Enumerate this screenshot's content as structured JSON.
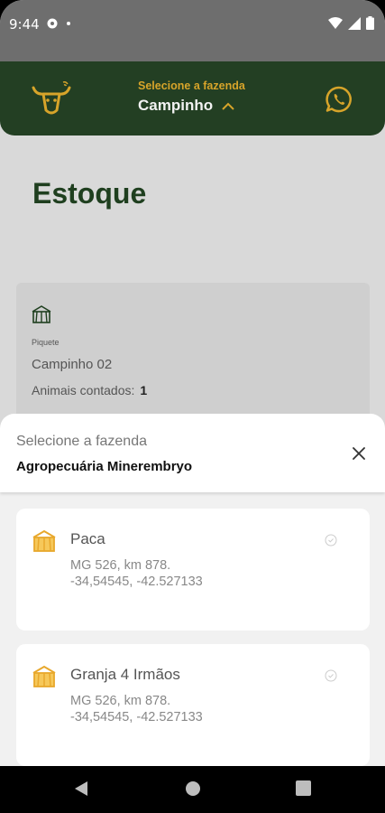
{
  "status_bar": {
    "time": "9:44",
    "notification_dot": "•"
  },
  "header": {
    "selector_label": "Selecione a fazenda",
    "selected_farm": "Campinho",
    "colors": {
      "bg": "#233f23",
      "accent": "#d7a42a"
    }
  },
  "page": {
    "title": "Estoque"
  },
  "piquete_card": {
    "type": "Piquete",
    "name": "Campinho 02",
    "count_label": "Animais contados:",
    "count_value": "1"
  },
  "sheet": {
    "label": "Selecione a fazenda",
    "value": "Agropecuária Minerembryo",
    "farms": [
      {
        "name": "Paca",
        "address1": "MG 526, km 878.",
        "address2": "-34,54545, -42.527133"
      },
      {
        "name": "Granja 4 Irmãos",
        "address1": "MG 526, km 878.",
        "address2": "-34,54545, -42.527133"
      }
    ]
  },
  "icons": {
    "logo": "bull-head-icon",
    "whatsapp": "whatsapp-icon",
    "close": "close-icon",
    "field": "field-icon",
    "check": "check-circle-icon"
  }
}
